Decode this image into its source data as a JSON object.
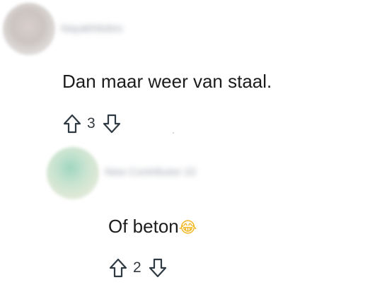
{
  "comments": [
    {
      "username": "Nayakhilobro",
      "text": "Dan maar weer van staal.",
      "votes": "3"
    },
    {
      "username": "New Contributor 22",
      "text": "Of beton",
      "emoji": "😂",
      "votes": "2"
    }
  ],
  "icons": {
    "upvote": "arrow-up-outline-icon",
    "downvote": "arrow-down-outline-icon"
  },
  "colors": {
    "text": "#1c1c1c",
    "icon": "#2f3a42"
  }
}
